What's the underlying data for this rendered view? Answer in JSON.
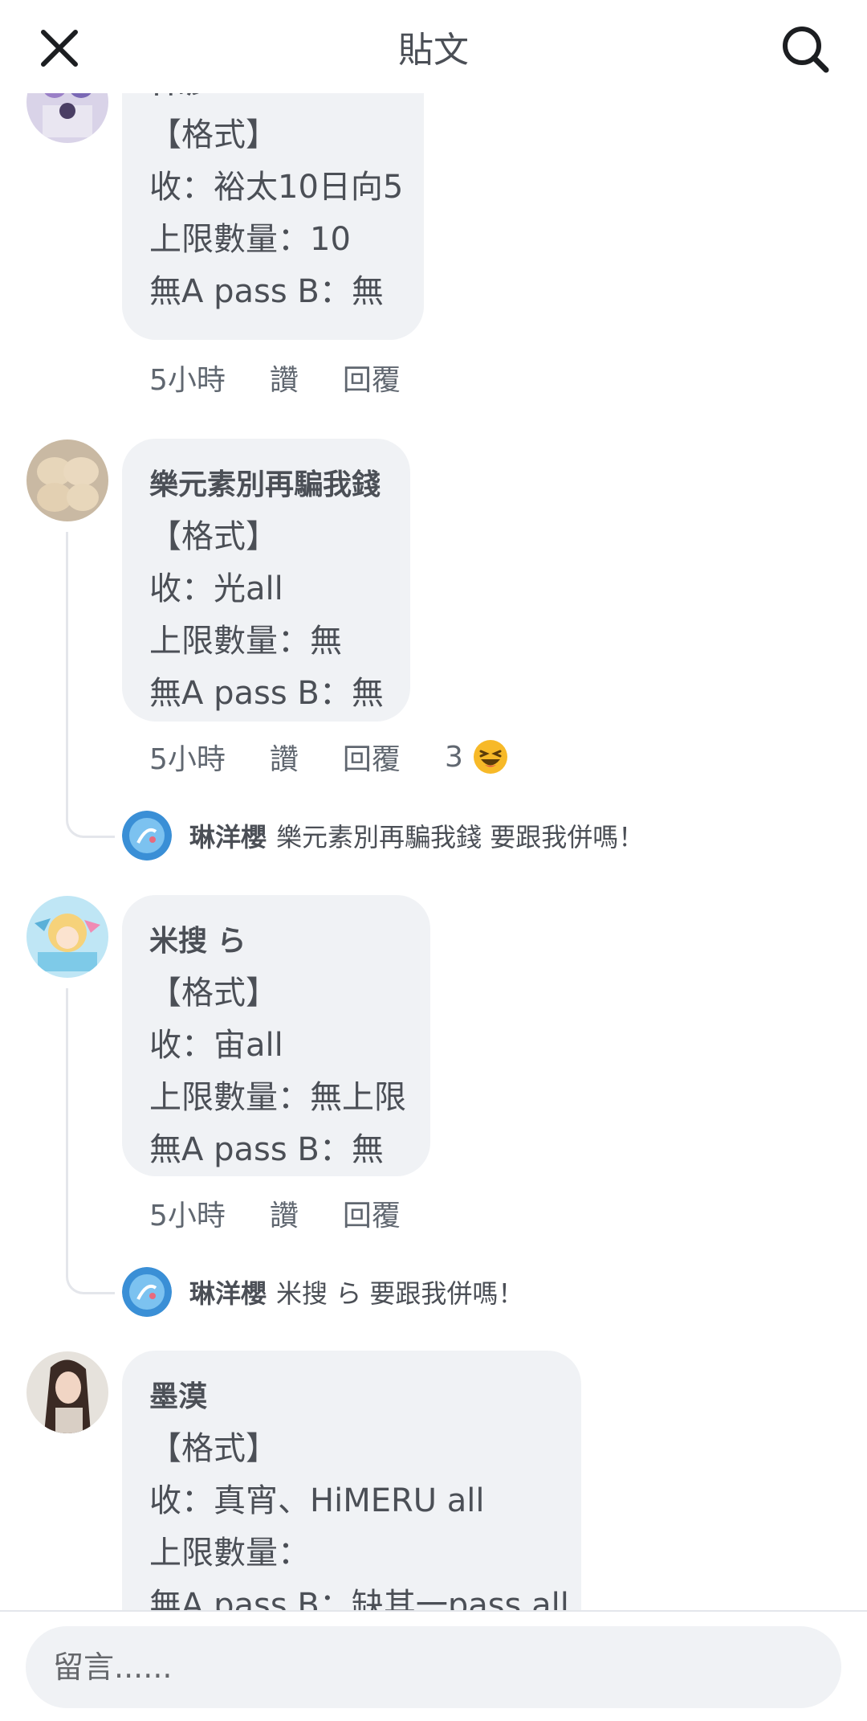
{
  "header": {
    "title": "貼文"
  },
  "comments": [
    {
      "name": "韓諺",
      "lines": [
        "【格式】",
        "收：裕太10日向5",
        "上限數量：10",
        "無A pass B：無"
      ],
      "actions": {
        "time": "5小時",
        "like": "讚",
        "reply": "回覆"
      }
    },
    {
      "name": "樂元素別再騙我錢",
      "lines": [
        "【格式】",
        "收：光all",
        "上限數量：無",
        "無A pass B：無"
      ],
      "actions": {
        "time": "5小時",
        "like": "讚",
        "reply": "回覆",
        "reaction_count": "3"
      },
      "reply": {
        "name": "琳洋櫻",
        "text": "樂元素別再騙我錢 要跟我併嗎！"
      }
    },
    {
      "name": "米搜 ら",
      "lines": [
        "【格式】",
        "收：宙all",
        "上限數量：無上限",
        "無A pass B：無"
      ],
      "actions": {
        "time": "5小時",
        "like": "讚",
        "reply": "回覆"
      },
      "reply": {
        "name": "琳洋櫻",
        "text": "米搜 ら 要跟我併嗎！"
      }
    },
    {
      "name": "墨漠",
      "lines": [
        "【格式】",
        "收：真宵、HiMERU all",
        "上限數量：",
        "無A pass B：缺其一pass all"
      ]
    }
  ],
  "composer": {
    "placeholder": "留言......"
  },
  "colors": {
    "bubble": "#f0f2f5",
    "text": "#4b4f56",
    "meta": "#606770"
  }
}
